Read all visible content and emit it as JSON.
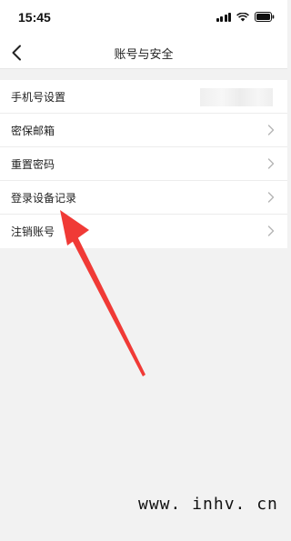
{
  "status_bar": {
    "time": "15:45"
  },
  "nav": {
    "title": "账号与安全",
    "back_icon": "chevron-left-icon"
  },
  "settings": {
    "items": [
      {
        "label": "手机号设置",
        "value_masked": true
      },
      {
        "label": "密保邮箱",
        "icon": "chevron-right-icon"
      },
      {
        "label": "重置密码",
        "icon": "chevron-right-icon"
      },
      {
        "label": "登录设备记录",
        "icon": "chevron-right-icon"
      },
      {
        "label": "注销账号",
        "icon": "chevron-right-icon"
      }
    ]
  },
  "annotation": {
    "color": "#f03a36",
    "points_to": "登录设备记录"
  },
  "watermark": {
    "text": "www. inhv. cn"
  }
}
